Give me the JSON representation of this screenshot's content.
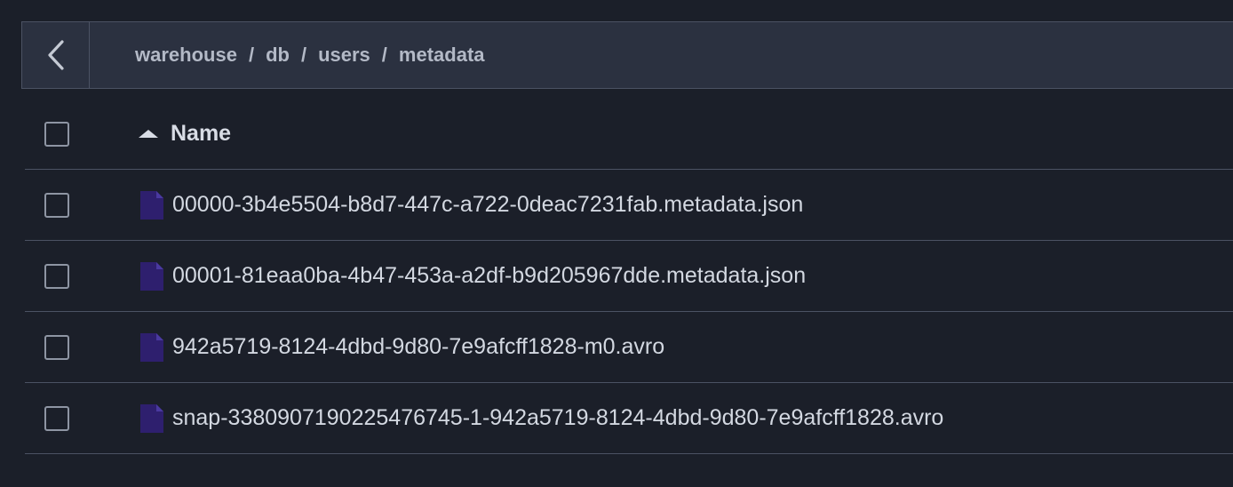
{
  "breadcrumb": [
    "warehouse",
    "db",
    "users",
    "metadata"
  ],
  "breadcrumb_separator": "/",
  "table": {
    "header_name": "Name",
    "sort_direction": "ascending",
    "rows": [
      {
        "name": "00000-3b4e5504-b8d7-447c-a722-0deac7231fab.metadata.json"
      },
      {
        "name": "00001-81eaa0ba-4b47-453a-a2df-b9d205967dde.metadata.json"
      },
      {
        "name": "942a5719-8124-4dbd-9d80-7e9afcff1828-m0.avro"
      },
      {
        "name": "snap-3380907190225476745-1-942a5719-8124-4dbd-9d80-7e9afcff1828.avro"
      }
    ]
  },
  "icons": {
    "back": "chevron-left-icon",
    "sort": "sort-ascending-icon",
    "file": "file-icon"
  },
  "colors": {
    "background": "#1b1f29",
    "toolbar": "#2b3140",
    "border": "#4b5263",
    "file_icon": "#2e1f6e"
  }
}
